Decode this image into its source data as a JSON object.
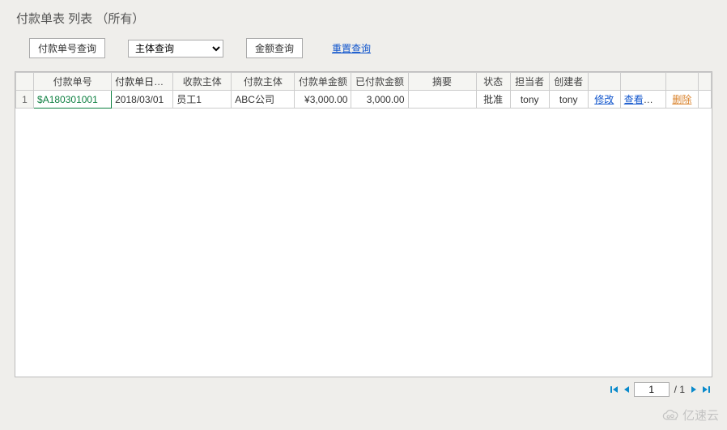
{
  "title": "付款单表 列表 （所有）",
  "filters": {
    "doc_no_query_label": "付款单号查询",
    "entity_query_label": "主体查询",
    "amount_query_label": "金额查询",
    "reset_label": "重置查询"
  },
  "columns": {
    "doc_no": "付款单号",
    "doc_date": "付款单日期",
    "payee": "收款主体",
    "payer": "付款主体",
    "amount": "付款单金额",
    "paid": "已付款金额",
    "summary": "摘要",
    "status": "状态",
    "owner": "担当者",
    "creator": "创建者"
  },
  "row": {
    "index": "1",
    "doc_no": "$A180301001",
    "doc_date": "2018/03/01",
    "payee": "员工1",
    "payer": "ABC公司",
    "amount": "¥3,000.00",
    "paid": "3,000.00",
    "summary": "",
    "status": "批准",
    "owner": "tony",
    "creator": "tony",
    "action_edit": "修改",
    "action_print": "查看打印",
    "action_delete": "删除"
  },
  "pager": {
    "current": "1",
    "total_label": "/ 1"
  },
  "watermark": "亿速云"
}
